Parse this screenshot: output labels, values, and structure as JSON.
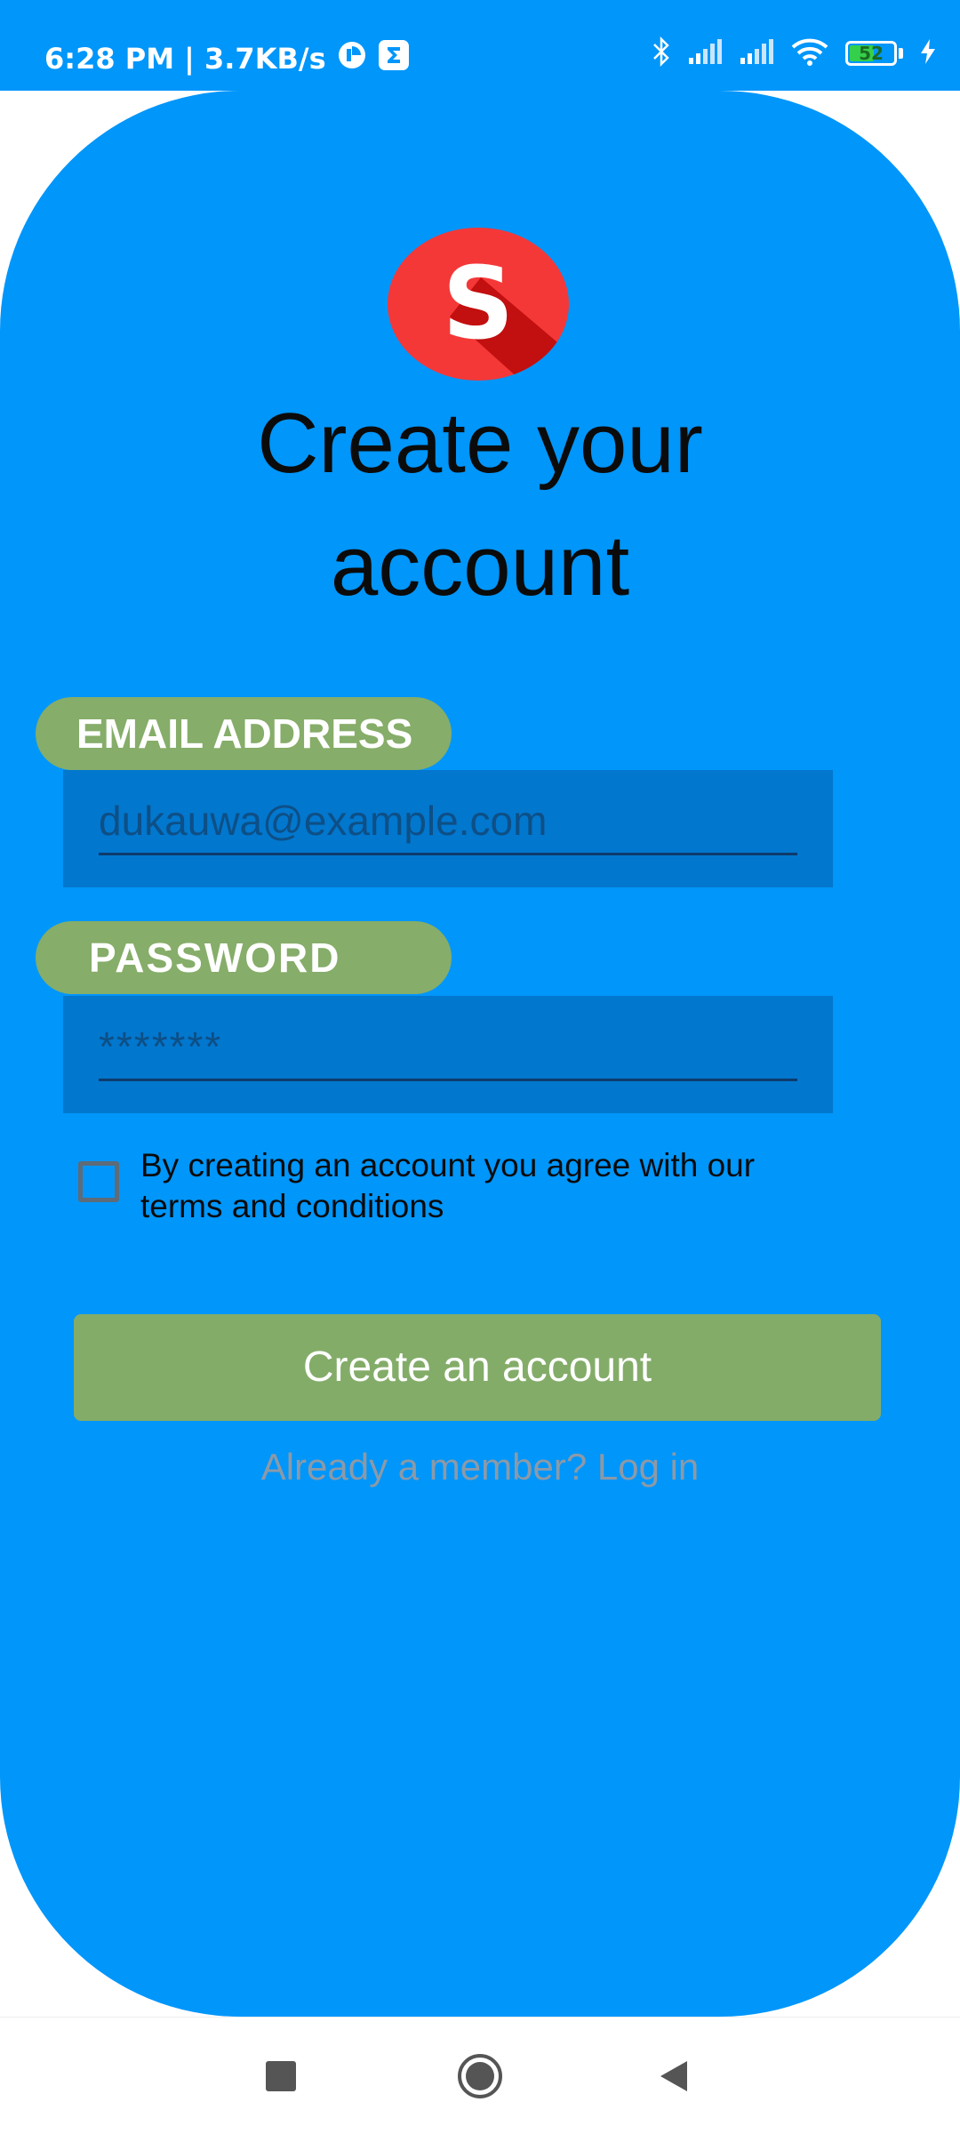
{
  "status_bar": {
    "time_speed": "6:28 PM | 3.7KB/s",
    "battery_level": "52",
    "icons": [
      "data-saver-icon",
      "sigma-app-icon",
      "bluetooth-icon",
      "signal-icon",
      "signal-icon",
      "wifi-icon",
      "battery-icon",
      "charging-icon"
    ]
  },
  "app": {
    "logo_letter": "S",
    "title": "Create your account"
  },
  "form": {
    "email_label": "EMAIL ADDRESS",
    "email_placeholder": "dukauwa@example.com",
    "password_label": "PASSWORD",
    "password_placeholder": "*******",
    "terms_text": "By creating an account you agree with our terms and conditions",
    "terms_checked": false,
    "submit_label": "Create an account",
    "login_link": "Already a member? Log in"
  },
  "nav_bar": {
    "buttons": [
      "recent-apps-icon",
      "home-icon",
      "back-icon"
    ]
  },
  "colors": {
    "panel_blue": "#0096fa",
    "input_blue": "#0277ce",
    "accent_green": "#83ac69",
    "logo_red": "#f43838"
  }
}
